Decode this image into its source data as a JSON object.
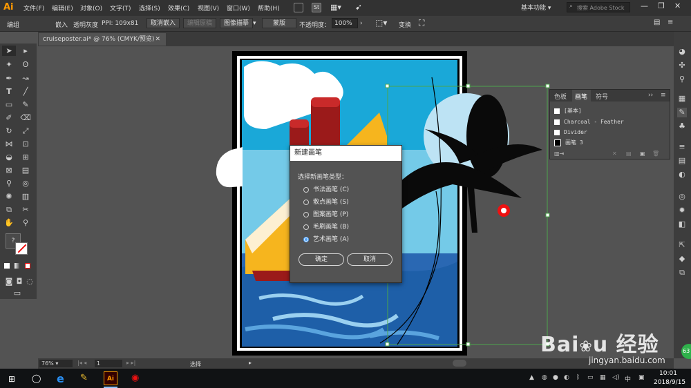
{
  "app": {
    "logo": "Ai"
  },
  "menubar": {
    "items": [
      "文件(F)",
      "编辑(E)",
      "对象(O)",
      "文字(T)",
      "选择(S)",
      "效果(C)",
      "视图(V)",
      "窗口(W)",
      "帮助(H)"
    ],
    "st_label": "St",
    "workspace": "基本功能",
    "search_placeholder": "搜索 Adobe Stock"
  },
  "controlbar": {
    "group_label": "编组",
    "embed": "嵌入",
    "transparent_gray": "透明灰度",
    "ppi": "PPI: 109x81",
    "unembed": "取消嵌入",
    "edit_original": "编辑原稿",
    "image_trace": "图像描摹",
    "mask": "蒙版",
    "opacity_label": "不透明度：",
    "opacity_value": "100%",
    "transform": "变换"
  },
  "document": {
    "tab_title": "cruiseposter.ai* @ 76% (CMYK/预览)"
  },
  "brush_panel": {
    "tabs": [
      "色板",
      "画笔",
      "符号"
    ],
    "items": [
      "[基本]",
      "Charcoal - Feather",
      "Divider",
      "画笔 3"
    ]
  },
  "dialog": {
    "title": "新建画笔",
    "prompt": "选择新画笔类型：",
    "options": [
      "书法画笔 (C)",
      "散点画笔 (S)",
      "图案画笔 (P)",
      "毛刷画笔 (B)",
      "艺术画笔 (A)"
    ],
    "selected_index": 4,
    "ok": "确定",
    "cancel": "取消"
  },
  "statusbar": {
    "zoom": "76%",
    "page": "1",
    "tool": "选择"
  },
  "taskbar": {
    "ime": "中",
    "time": "10:01",
    "date": "2018/9/15",
    "notif_badge": "63"
  },
  "watermark": {
    "brand": "Bai",
    "brand_cn": "经验",
    "url": "jingyan.baidu.com"
  },
  "colors": {
    "sky": "#1aa8d8",
    "sea": "#1e5fa8",
    "hull": "#f6b51e",
    "funnel": "#9b1a1a",
    "selection": "#4ca64c"
  }
}
